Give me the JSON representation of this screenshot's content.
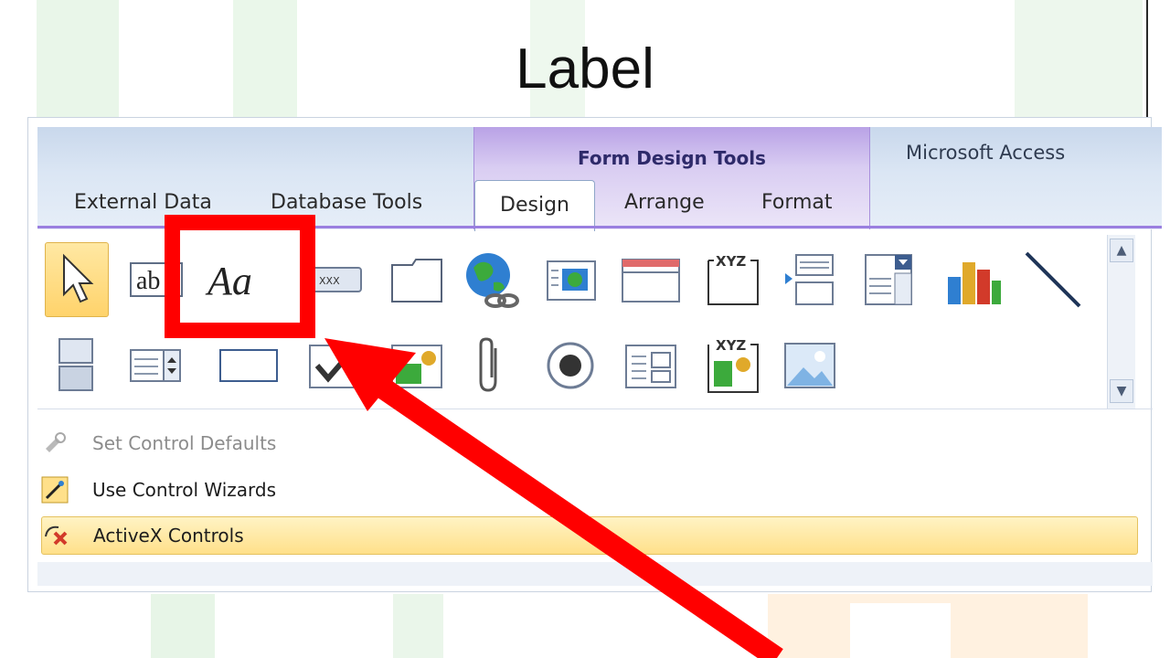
{
  "slide": {
    "title": "Label"
  },
  "ribbon": {
    "contextual_group": "Form Design Tools",
    "app_title": "Microsoft Access",
    "tabs": [
      "External Data",
      "Database Tools",
      "Design",
      "Arrange",
      "Format"
    ],
    "active_tab": "Design"
  },
  "gallery": {
    "row1": [
      {
        "icon": "select-pointer-icon",
        "selected": true
      },
      {
        "icon": "text-box-icon",
        "glyph": "ab"
      },
      {
        "icon": "label-icon",
        "glyph": "Aa"
      },
      {
        "icon": "button-icon",
        "glyph": "XXX"
      },
      {
        "icon": "tab-control-icon"
      },
      {
        "icon": "hyperlink-globe-icon"
      },
      {
        "icon": "web-browser-icon"
      },
      {
        "icon": "navigation-control-icon"
      },
      {
        "icon": "option-group-icon",
        "glyph": "XYZ"
      },
      {
        "icon": "insert-page-break-icon"
      },
      {
        "icon": "combo-box-icon"
      },
      {
        "icon": "chart-icon"
      },
      {
        "icon": "line-icon"
      }
    ],
    "row2": [
      {
        "icon": "toggle-button-icon"
      },
      {
        "icon": "list-box-icon"
      },
      {
        "icon": "rectangle-icon"
      },
      {
        "icon": "check-box-icon"
      },
      {
        "icon": "unbound-object-frame-icon"
      },
      {
        "icon": "attachment-icon"
      },
      {
        "icon": "option-button-icon"
      },
      {
        "icon": "subform-icon"
      },
      {
        "icon": "bound-object-frame-icon",
        "glyph": "XYZ"
      },
      {
        "icon": "image-icon"
      }
    ]
  },
  "menu": {
    "items": [
      {
        "label": "Set Control Defaults",
        "enabled": false
      },
      {
        "label": "Use Control Wizards",
        "enabled": true
      },
      {
        "label": "ActiveX Controls",
        "enabled": true,
        "highlighted": true
      }
    ]
  },
  "colors": {
    "highlight": "#ff0000",
    "context_purple": "#9a7fe0",
    "selected_gold": "#ffd36b"
  }
}
